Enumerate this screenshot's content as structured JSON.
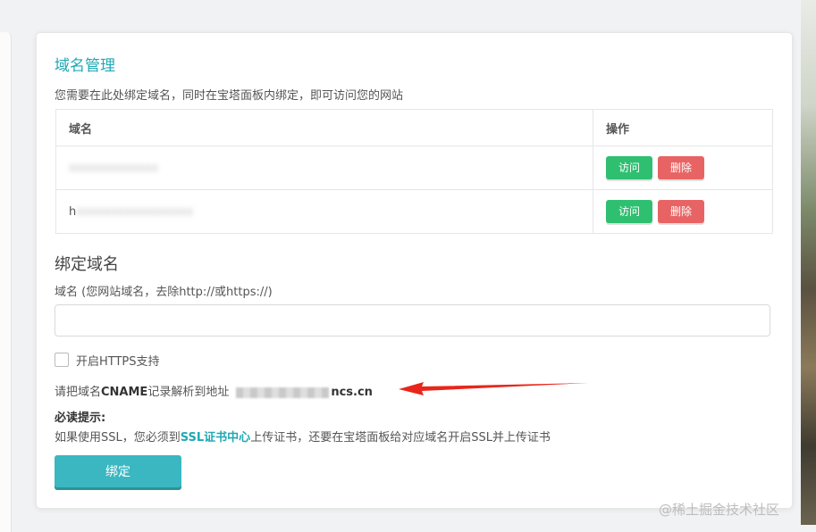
{
  "domain_management": {
    "title": "域名管理",
    "description": "您需要在此处绑定域名，同时在宝塔面板内绑定，即可访问您的网站",
    "table": {
      "headers": [
        "域名",
        "操作"
      ],
      "rows": [
        {
          "domain": "xxxxxxxxxxxxx",
          "visit_label": "访问",
          "delete_label": "删除"
        },
        {
          "domain": "h",
          "domain_rest": "xxxxxxxxxxxxxxxxx",
          "visit_label": "访问",
          "delete_label": "删除"
        }
      ]
    }
  },
  "bind_domain": {
    "title": "绑定域名",
    "field_label": "域名 (您网站域名，去除http://或https://)",
    "input_value": "",
    "https_label": "开启HTTPS支持",
    "cname_prefix": "请把域名",
    "cname_bold": "CNAME",
    "cname_suffix": "记录解析到地址",
    "cname_address_tail": "ncs.cn",
    "notice_title": "必读提示:",
    "notice_before": "如果使用SSL，您必须到",
    "notice_link": "SSL证书中心",
    "notice_after": "上传证书，还要在宝塔面板给对应域名开启SSL并上传证书",
    "submit_label": "绑定"
  },
  "watermark": "@稀土掘金技术社区",
  "colors": {
    "accent": "#20a8b4",
    "visit_button": "#2fbf71",
    "delete_button": "#e86464",
    "bind_button": "#3bb7c1",
    "arrow": "#e8261c"
  },
  "icons": [
    "red-arrow-annotation"
  ]
}
